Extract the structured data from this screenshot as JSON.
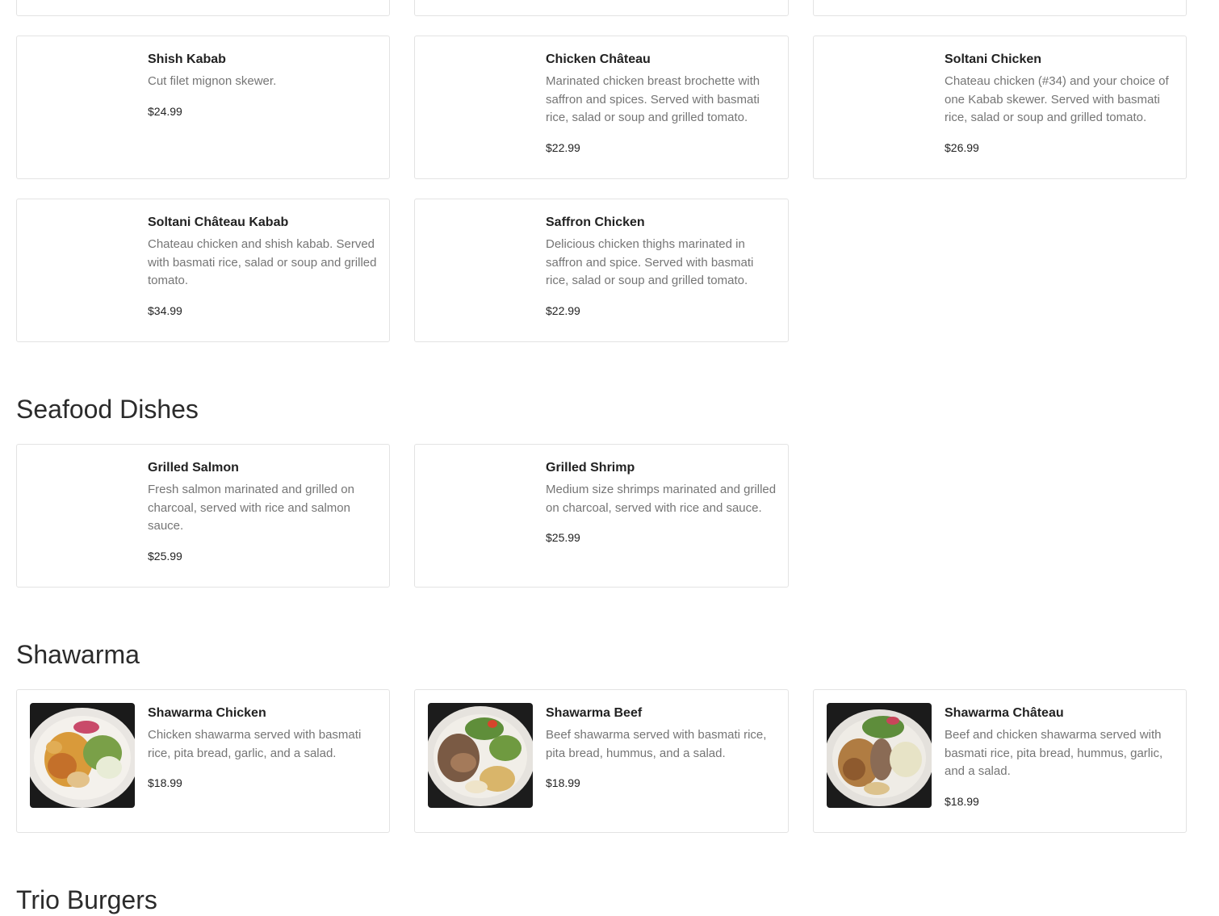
{
  "sections": {
    "seafood": {
      "title": "Seafood Dishes"
    },
    "shawarma": {
      "title": "Shawarma"
    },
    "trio_burgers": {
      "title": "Trio Burgers"
    }
  },
  "items": {
    "shish_kabab": {
      "name": "Shish Kabab",
      "description": "Cut filet mignon skewer.",
      "price": "$24.99"
    },
    "chicken_chateau": {
      "name": "Chicken Château",
      "description": "Marinated chicken breast brochette with saffron and spices. Served with basmati rice, salad or soup and grilled tomato.",
      "price": "$22.99"
    },
    "soltani_chicken": {
      "name": "Soltani Chicken",
      "description": "Chateau chicken (#34) and your choice of one Kabab skewer. Served with basmati rice, salad or soup and grilled tomato.",
      "price": "$26.99"
    },
    "soltani_chateau_kabab": {
      "name": "Soltani Château Kabab",
      "description": "Chateau chicken and shish kabab. Served with basmati rice, salad or soup and grilled tomato.",
      "price": "$34.99"
    },
    "saffron_chicken": {
      "name": "Saffron Chicken",
      "description": "Delicious chicken thighs marinated in saffron and spice. Served with basmati rice, salad or soup and grilled tomato.",
      "price": "$22.99"
    },
    "grilled_salmon": {
      "name": "Grilled Salmon",
      "description": "Fresh salmon marinated and grilled on charcoal, served with rice and salmon sauce.",
      "price": "$25.99"
    },
    "grilled_shrimp": {
      "name": "Grilled Shrimp",
      "description": "Medium size shrimps marinated and grilled on charcoal, served with rice and sauce.",
      "price": "$25.99"
    },
    "shawarma_chicken": {
      "name": "Shawarma Chicken",
      "description": "Chicken shawarma served with basmati rice, pita bread, garlic, and a salad.",
      "price": "$18.99"
    },
    "shawarma_beef": {
      "name": "Shawarma Beef",
      "description": "Beef shawarma served with basmati rice, pita bread, hummus, and a salad.",
      "price": "$18.99"
    },
    "shawarma_chateau": {
      "name": "Shawarma Château",
      "description": "Beef and chicken shawarma served with basmati rice, pita bread, hummus, garlic, and a salad.",
      "price": "$18.99"
    }
  },
  "photos": {
    "shawarma_chicken": "shawarma-chicken-photo",
    "shawarma_beef": "shawarma-beef-photo",
    "shawarma_chateau": "shawarma-chateau-photo"
  }
}
